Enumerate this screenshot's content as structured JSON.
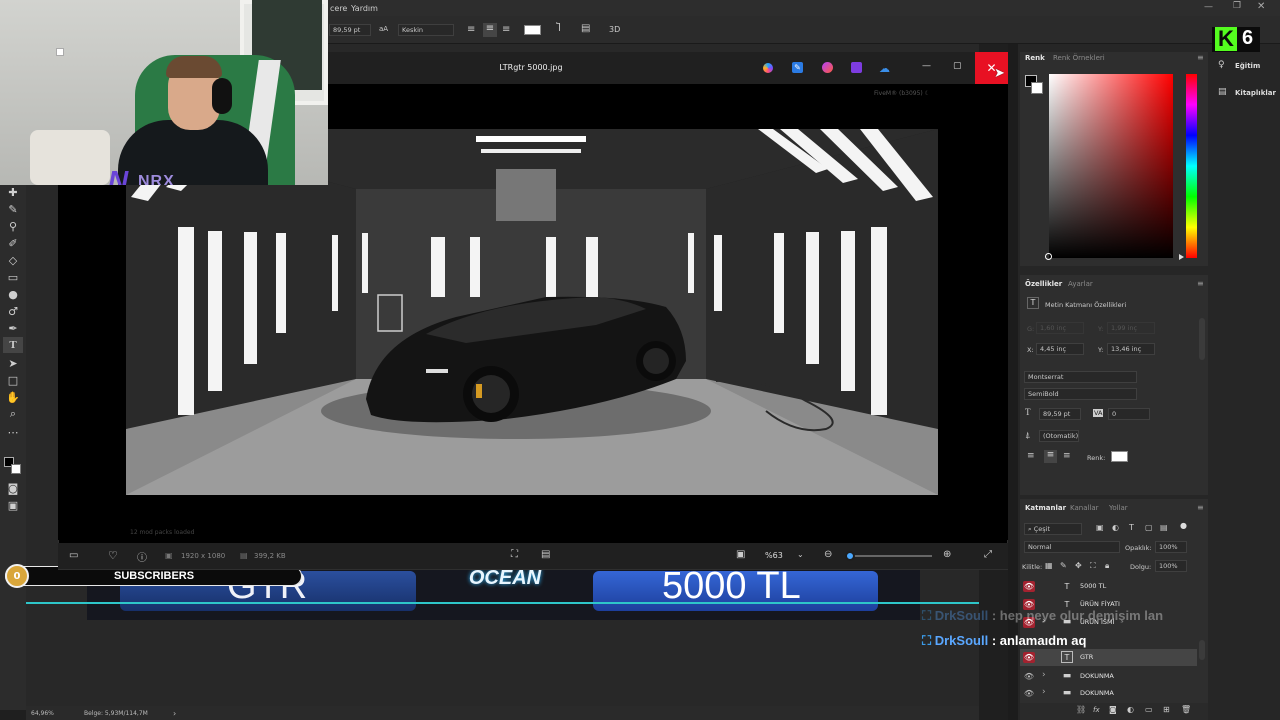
{
  "menubar": {
    "items": [
      "cere",
      "Yardım"
    ]
  },
  "options_bar": {
    "font_size": "89,59 pt",
    "antialias_icon": "aA",
    "antialias": "Keskin",
    "three_d": "3D"
  },
  "viewer": {
    "title": "LTRgtr 5000.jpg",
    "watermark": "FiveM® (b3095) ☾",
    "status_text": "12 mod packs loaded",
    "dimensions": "1920 x 1080",
    "filesize": "399,2 KB",
    "zoom": "%63",
    "zoom_level": 0.05
  },
  "streamer_overlay": {
    "logo_text": "NRX",
    "subscriber_count": "0",
    "subscribers_label": "SUBSCRIBERS",
    "brand_text": "OCEAN",
    "car_label": "GTR",
    "price_label": "5000 TL",
    "chat": [
      {
        "user": "DrkSoull",
        "sep": " : ",
        "message": "hep neye olur demişim lan"
      },
      {
        "user": "DrkSoull",
        "sep": " : ",
        "message": "anlamaıdm aq"
      }
    ]
  },
  "app_status": {
    "zoom": "64,96%",
    "doc": "Belge: 5,93M/114,7M",
    "arrow": "›"
  },
  "color_panel": {
    "tab_active": "Renk",
    "tab_inactive": "Renk Örnekleri",
    "hue_color": "#ff0000"
  },
  "learn_panel": {
    "learn": "Eğitim",
    "libraries": "Kitaplıklar",
    "counter": "6"
  },
  "properties_panel": {
    "tab_active": "Özellikler",
    "tab_inactive": "Ayarlar",
    "section": "Metin Katmanı Özellikleri",
    "w_label": "G:",
    "w_value": "1,60 inç",
    "h_label": "Y:",
    "h_value": "1,99 inç",
    "x_label": "X:",
    "x_value": "4,45 inç",
    "y_label": "Y:",
    "y_value": "13,46 inç",
    "font": "Montserrat",
    "style": "SemiBold",
    "size": "89,59 pt",
    "tracking_icon": "VA",
    "tracking": "0",
    "leading": "(Otomatik)",
    "color_label": "Renk:"
  },
  "layers_panel": {
    "tab_active": "Katmanlar",
    "tab_2": "Kanallar",
    "tab_3": "Yollar",
    "filter": "Çeşit",
    "blend_mode": "Normal",
    "opacity_label": "Opaklık:",
    "opacity": "100%",
    "lock_label": "Kilitle:",
    "fill_label": "Dolgu:",
    "fill": "100%",
    "fx": "fx",
    "layers": [
      {
        "name": "5000 TL",
        "type": "text",
        "visible": true,
        "selected": false
      },
      {
        "name": "ÜRÜN FİYATI",
        "type": "text",
        "visible": true,
        "selected": false
      },
      {
        "name": "ÜRÜN İSMİ",
        "type": "group",
        "visible": true,
        "selected": false
      },
      {
        "name": "GTR",
        "type": "text",
        "visible": true,
        "selected": true
      },
      {
        "name": "DOKUNMA",
        "type": "group",
        "visible": false,
        "selected": false
      },
      {
        "name": "DOKUNMA",
        "type": "group",
        "visible": false,
        "selected": false
      }
    ]
  }
}
